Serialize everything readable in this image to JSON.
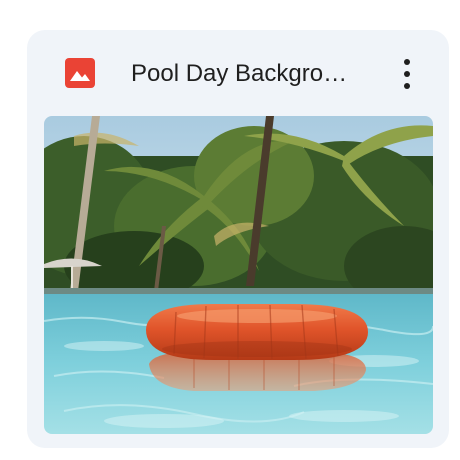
{
  "file": {
    "title": "Pool Day Backgro…",
    "type_icon": "image-file-icon",
    "type_icon_color": "#ea4335"
  },
  "menu": {
    "icon": "more-vert-icon"
  },
  "thumbnail": {
    "subject": "pool-float-palm-trees-image"
  },
  "colors": {
    "card_background": "#f0f4f9",
    "title_text": "#1f1f1f"
  }
}
